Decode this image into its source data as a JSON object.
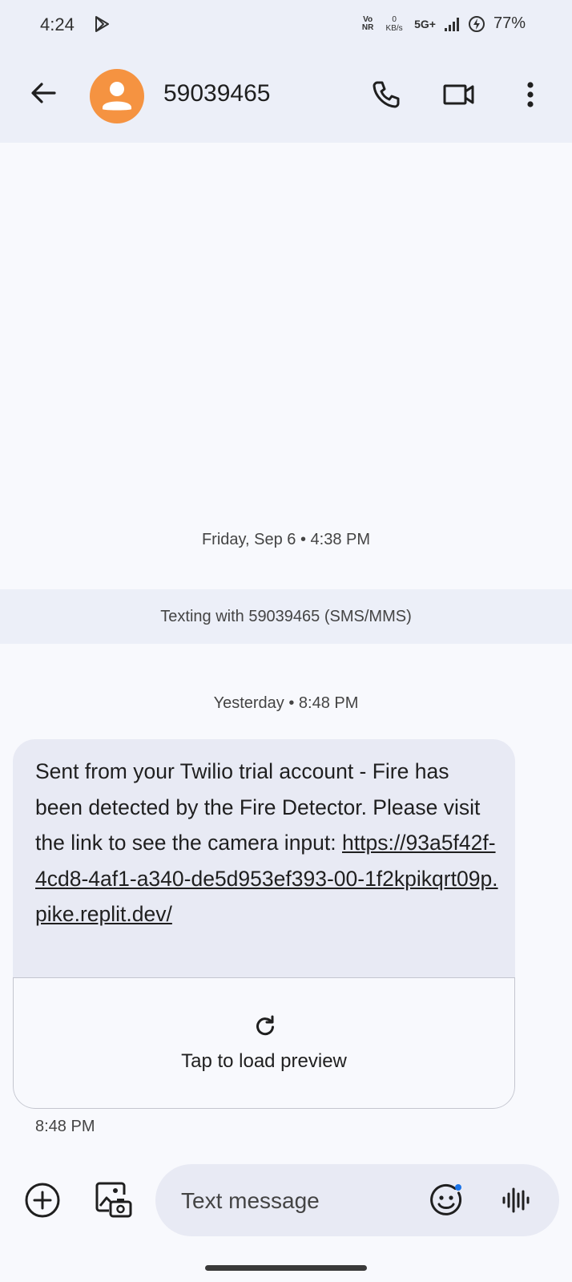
{
  "status_bar": {
    "time": "4:24",
    "volte_top": "Vo",
    "volte_bottom": "NR",
    "speed_value": "0",
    "speed_unit": "KB/s",
    "network": "5G+",
    "battery": "77%"
  },
  "app_bar": {
    "contact": "59039465",
    "avatar_color": "#f59341"
  },
  "conversation": {
    "date_1": "Friday, Sep 6 • 4:38 PM",
    "banner": "Texting with 59039465 (SMS/MMS)",
    "date_2": "Yesterday • 8:48 PM",
    "message": {
      "text": "Sent from your Twilio trial account - Fire has been detected by the Fire Detector. Please visit the link to see the camera input:",
      "link": "https://93a5f42f-4cd8-4af1-a340-de5d953ef393-00-1f2kpikqrt09p.pike.replit.dev/",
      "preview_label": "Tap to load preview",
      "time": "8:48 PM"
    }
  },
  "compose": {
    "placeholder": "Text message"
  },
  "colors": {
    "app_bar_bg": "#eceff8",
    "bubble_bg": "#e8eaf4",
    "emoji_dot": "#1a73e8"
  }
}
